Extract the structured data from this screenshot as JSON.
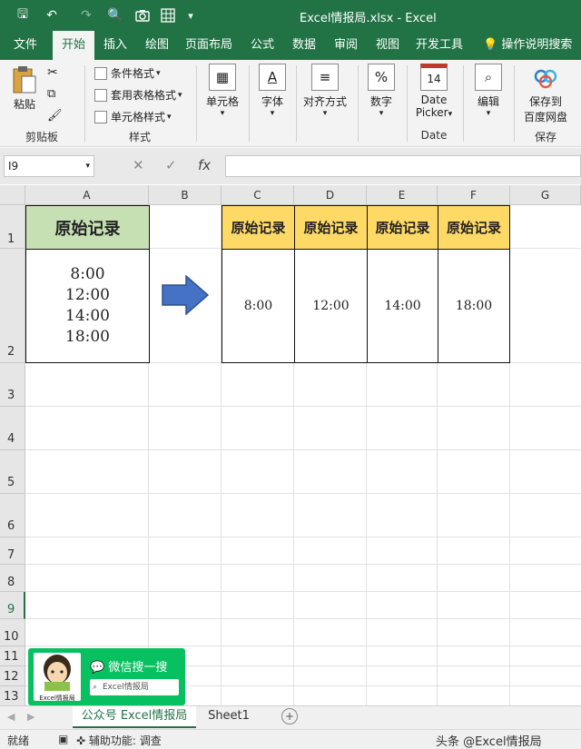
{
  "title": "Excel情报局.xlsx  -  Excel",
  "quick_access": {
    "save": "🖫",
    "undo": "↶",
    "redo": "↷",
    "preview": "🔍",
    "more": "▾"
  },
  "tabs": [
    "文件",
    "开始",
    "插入",
    "绘图",
    "页面布局",
    "公式",
    "数据",
    "审阅",
    "视图",
    "开发工具"
  ],
  "active_tab_index": 1,
  "tell_me": "操作说明搜索",
  "ribbon": {
    "paste_label": "粘贴",
    "clipboard_label": "剪贴板",
    "conditional_format": "条件格式",
    "table_format": "套用表格格式",
    "cell_styles": "单元格样式",
    "styles_label": "样式",
    "cells": "单元格",
    "font": "字体",
    "alignment": "对齐方式",
    "number": "数字",
    "date_picker_1": "Date",
    "date_picker_2": "Picker",
    "date_group": "Date",
    "date_icon_text": "14",
    "edit": "编辑",
    "save_to_1": "保存到",
    "save_to_2": "百度网盘",
    "save_group": "保存"
  },
  "formula_bar": {
    "name_box": "I9",
    "cancel": "✕",
    "enter": "✓",
    "fx": "fx"
  },
  "columns": [
    "A",
    "B",
    "C",
    "D",
    "E",
    "F",
    "G"
  ],
  "rows": [
    "1",
    "2",
    "3",
    "4",
    "5",
    "6",
    "7",
    "8",
    "9",
    "10",
    "11",
    "12",
    "13"
  ],
  "cells": {
    "A1": "原始记录",
    "A2_lines": [
      "8:00",
      "12:00",
      "14:00",
      "18:00"
    ],
    "C1": "原始记录",
    "D1": "原始记录",
    "E1": "原始记录",
    "F1": "原始记录",
    "C2": "8:00",
    "D2": "12:00",
    "E2": "14:00",
    "F2": "18:00"
  },
  "colors": {
    "excel_green": "#217346",
    "header_green": "#c6e0b4",
    "header_gold": "#ffd966",
    "arrow_blue": "#4472c4",
    "wechat_green": "#07c160"
  },
  "wechat_card": {
    "title": "微信搜一搜",
    "search": "Excel情报局",
    "avatar_caption": "Excel情报局"
  },
  "sheets": [
    "公众号 Excel情报局",
    "Sheet1"
  ],
  "active_sheet_index": 0,
  "add_sheet": "+",
  "status": {
    "ready": "就绪",
    "accessibility": "辅助功能: 调查",
    "watermark": "头条 @Excel情报局"
  }
}
